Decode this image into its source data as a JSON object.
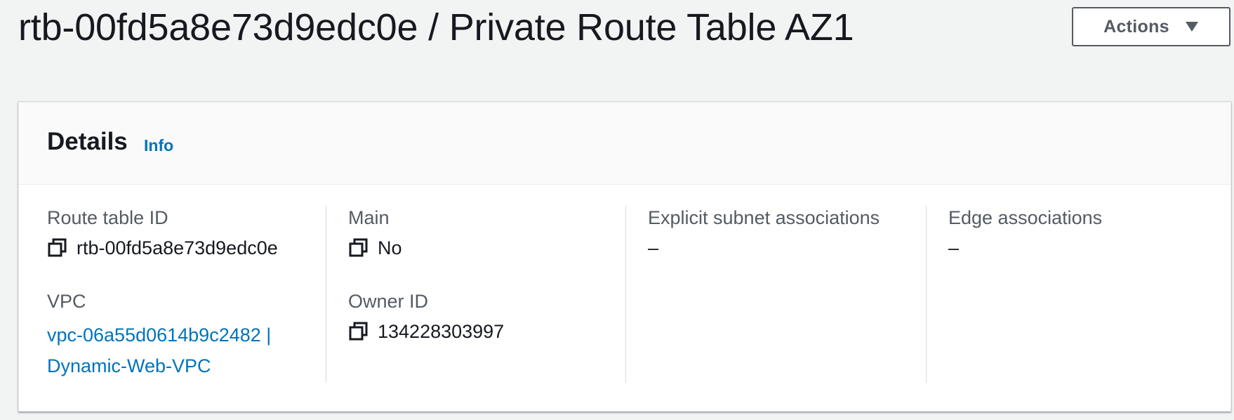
{
  "header": {
    "title": "rtb-00fd5a8e73d9edc0e / Private Route Table AZ1",
    "actions_label": "Actions",
    "actions_icon": "caret-down-icon"
  },
  "details": {
    "title": "Details",
    "info_label": "Info",
    "route_table_id": {
      "label": "Route table ID",
      "value": "rtb-00fd5a8e73d9edc0e",
      "icon": "copy-icon"
    },
    "vpc": {
      "label": "VPC",
      "line1": "vpc-06a55d0614b9c2482 |",
      "line2": "Dynamic-Web-VPC"
    },
    "main": {
      "label": "Main",
      "value": "No",
      "icon": "copy-icon"
    },
    "owner_id": {
      "label": "Owner ID",
      "value": "134228303997",
      "icon": "copy-icon"
    },
    "explicit_subnet_associations": {
      "label": "Explicit subnet associations",
      "value": "–"
    },
    "edge_associations": {
      "label": "Edge associations",
      "value": "–"
    }
  },
  "colors": {
    "link": "#0073bb",
    "text": "#16191f",
    "label": "#545b64",
    "background": "#f2f3f3"
  }
}
